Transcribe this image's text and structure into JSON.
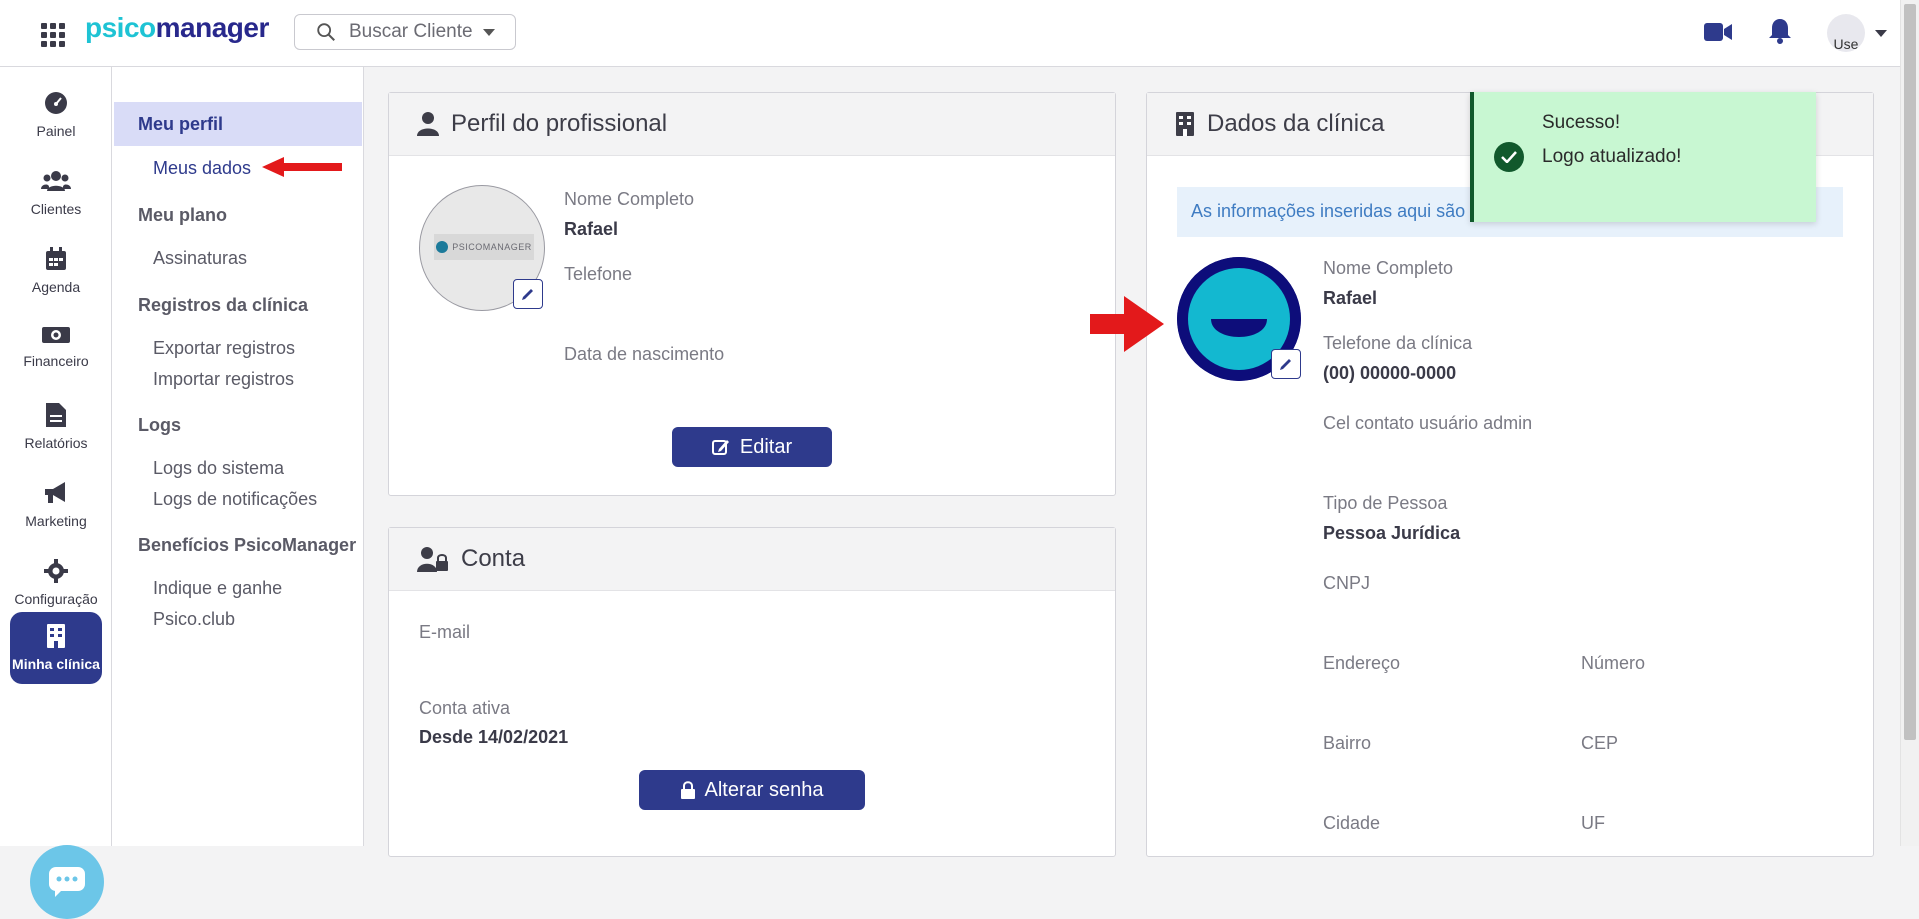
{
  "app": {
    "logo_part1": "psico",
    "logo_part2": "manager"
  },
  "search": {
    "label": "Buscar Cliente"
  },
  "header": {
    "avatar_alt": "Use"
  },
  "rail": {
    "items": [
      {
        "label": "Painel",
        "icon": "dashboard-icon"
      },
      {
        "label": "Clientes",
        "icon": "users-icon"
      },
      {
        "label": "Agenda",
        "icon": "calendar-icon"
      },
      {
        "label": "Financeiro",
        "icon": "money-icon"
      },
      {
        "label": "Relatórios",
        "icon": "report-icon"
      },
      {
        "label": "Marketing",
        "icon": "megaphone-icon"
      },
      {
        "label": "Configuração",
        "icon": "gear-icon"
      },
      {
        "label": "Minha clínica",
        "icon": "building-icon"
      }
    ]
  },
  "subnav": {
    "meu_perfil": "Meu perfil",
    "meus_dados": "Meus dados",
    "meu_plano": "Meu plano",
    "assinaturas": "Assinaturas",
    "registros": "Registros da clínica",
    "exportar": "Exportar registros",
    "importar": "Importar registros",
    "logs": "Logs",
    "logs_sistema": "Logs do sistema",
    "logs_notif": "Logs de notificações",
    "beneficios": "Benefícios PsicoManager",
    "indique": "Indique e ganhe",
    "psicoclub": "Psico.club"
  },
  "perfil": {
    "title": "Perfil do profissional",
    "photo_text": "PSICOMANAGER",
    "nome_label": "Nome Completo",
    "nome_value": "Rafael",
    "telefone_label": "Telefone",
    "nascimento_label": "Data de nascimento",
    "editar_label": "Editar"
  },
  "conta": {
    "title": "Conta",
    "email_label": "E-mail",
    "ativa_label": "Conta ativa",
    "ativa_value": "Desde 14/02/2021",
    "senha_label": "Alterar senha"
  },
  "clinica": {
    "title": "Dados da clínica",
    "info": "As informações inseridas aqui são u",
    "nome_label": "Nome Completo",
    "nome_value": "Rafael",
    "tel_label": "Telefone da clínica",
    "tel_value": "(00) 00000-0000",
    "cel_label": "Cel contato usuário admin",
    "tipo_label": "Tipo de Pessoa",
    "tipo_value": "Pessoa Jurídica",
    "cnpj_label": "CNPJ",
    "endereco_label": "Endereço",
    "numero_label": "Número",
    "bairro_label": "Bairro",
    "cep_label": "CEP",
    "cidade_label": "Cidade",
    "uf_label": "UF"
  },
  "toast": {
    "title": "Sucesso!",
    "message": "Logo atualizado!"
  },
  "colors": {
    "primary": "#2e3a8c",
    "accent": "#1ec3d4",
    "success_bg": "#c8f7d2",
    "success_border": "#11592c",
    "annotation": "#e3191b"
  }
}
